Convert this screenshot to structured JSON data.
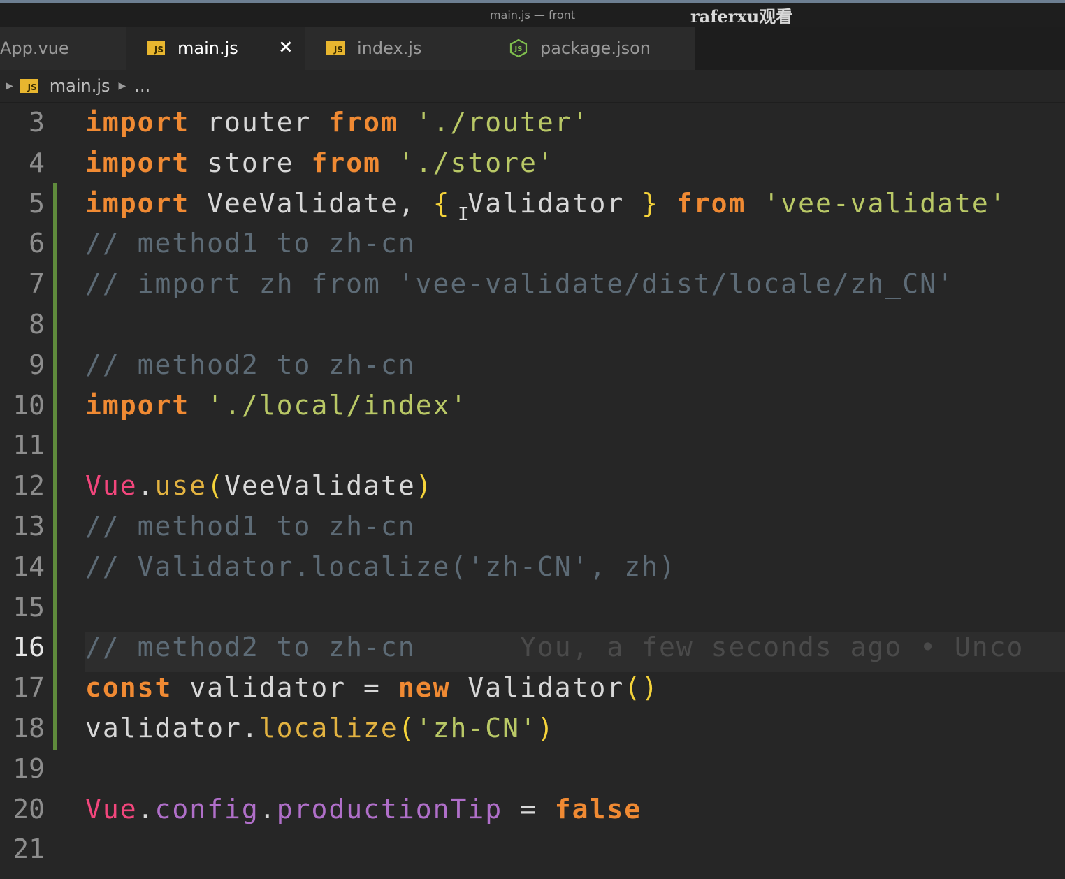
{
  "window": {
    "title": "main.js — front",
    "watermark": "raferxu观看"
  },
  "tabs": [
    {
      "label": "App.vue",
      "icon": "vue-file-icon"
    },
    {
      "label": "main.js",
      "icon": "js-file-icon",
      "active": true
    },
    {
      "label": "index.js",
      "icon": "js-file-icon"
    },
    {
      "label": "package.json",
      "icon": "nodejs-icon"
    }
  ],
  "js_icon_text": "JS",
  "close_glyph": "×",
  "breadcrumb": {
    "file": "main.js",
    "more": "..."
  },
  "lines": [
    {
      "n": "3",
      "tokens": [
        [
          "kw",
          "import"
        ],
        [
          "ident",
          " router "
        ],
        [
          "kw",
          "from"
        ],
        [
          "ident",
          " "
        ],
        [
          "str",
          "'./router'"
        ]
      ]
    },
    {
      "n": "4",
      "tokens": [
        [
          "kw",
          "import"
        ],
        [
          "ident",
          " store "
        ],
        [
          "kw",
          "from"
        ],
        [
          "ident",
          " "
        ],
        [
          "str",
          "'./store'"
        ]
      ]
    },
    {
      "n": "5",
      "tokens": [
        [
          "kw",
          "import"
        ],
        [
          "ident",
          " VeeValidate, "
        ],
        [
          "yel",
          "{"
        ],
        [
          "ident",
          " Validator "
        ],
        [
          "yel",
          "}"
        ],
        [
          "ident",
          " "
        ],
        [
          "kw",
          "from"
        ],
        [
          "ident",
          " "
        ],
        [
          "str",
          "'vee-validate'"
        ]
      ]
    },
    {
      "n": "6",
      "tokens": [
        [
          "cm",
          "// method1 to zh-cn"
        ]
      ]
    },
    {
      "n": "7",
      "tokens": [
        [
          "cm",
          "// import zh from 'vee-validate/dist/locale/zh_CN'"
        ]
      ]
    },
    {
      "n": "8",
      "tokens": []
    },
    {
      "n": "9",
      "tokens": [
        [
          "cm",
          "// method2 to zh-cn"
        ]
      ]
    },
    {
      "n": "10",
      "tokens": [
        [
          "kw",
          "import"
        ],
        [
          "ident",
          " "
        ],
        [
          "str",
          "'./local/index'"
        ]
      ]
    },
    {
      "n": "11",
      "tokens": []
    },
    {
      "n": "12",
      "tokens": [
        [
          "pink",
          "Vue"
        ],
        [
          "ident",
          "."
        ],
        [
          "fn",
          "use"
        ],
        [
          "yel",
          "("
        ],
        [
          "ident",
          "VeeValidate"
        ],
        [
          "yel",
          ")"
        ]
      ]
    },
    {
      "n": "13",
      "tokens": [
        [
          "cm",
          "// method1 to zh-cn"
        ]
      ]
    },
    {
      "n": "14",
      "tokens": [
        [
          "cm",
          "// Validator.localize('zh-CN', zh)"
        ]
      ]
    },
    {
      "n": "15",
      "tokens": []
    },
    {
      "n": "16",
      "tokens": [
        [
          "cm",
          "// method2 to zh-cn"
        ],
        [
          "blame",
          "      You, a few seconds ago • Unco"
        ]
      ],
      "current": true
    },
    {
      "n": "17",
      "tokens": [
        [
          "kw",
          "const"
        ],
        [
          "ident",
          " validator = "
        ],
        [
          "kw",
          "new"
        ],
        [
          "ident",
          " Validator"
        ],
        [
          "yel",
          "()"
        ]
      ]
    },
    {
      "n": "18",
      "tokens": [
        [
          "ident",
          "validator."
        ],
        [
          "fn",
          "localize"
        ],
        [
          "yel",
          "("
        ],
        [
          "str",
          "'zh-CN'"
        ],
        [
          "yel",
          ")"
        ]
      ]
    },
    {
      "n": "19",
      "tokens": []
    },
    {
      "n": "20",
      "tokens": [
        [
          "pink",
          "Vue"
        ],
        [
          "ident",
          "."
        ],
        [
          "purple",
          "config"
        ],
        [
          "ident",
          "."
        ],
        [
          "purple",
          "productionTip"
        ],
        [
          "ident",
          " = "
        ],
        [
          "kw",
          "false"
        ]
      ]
    },
    {
      "n": "21",
      "tokens": []
    }
  ],
  "colors": {
    "accent": "#f08a33",
    "string": "#b9c866",
    "comment": "#5d6b76",
    "modified_bar": "#5f8b3c"
  }
}
